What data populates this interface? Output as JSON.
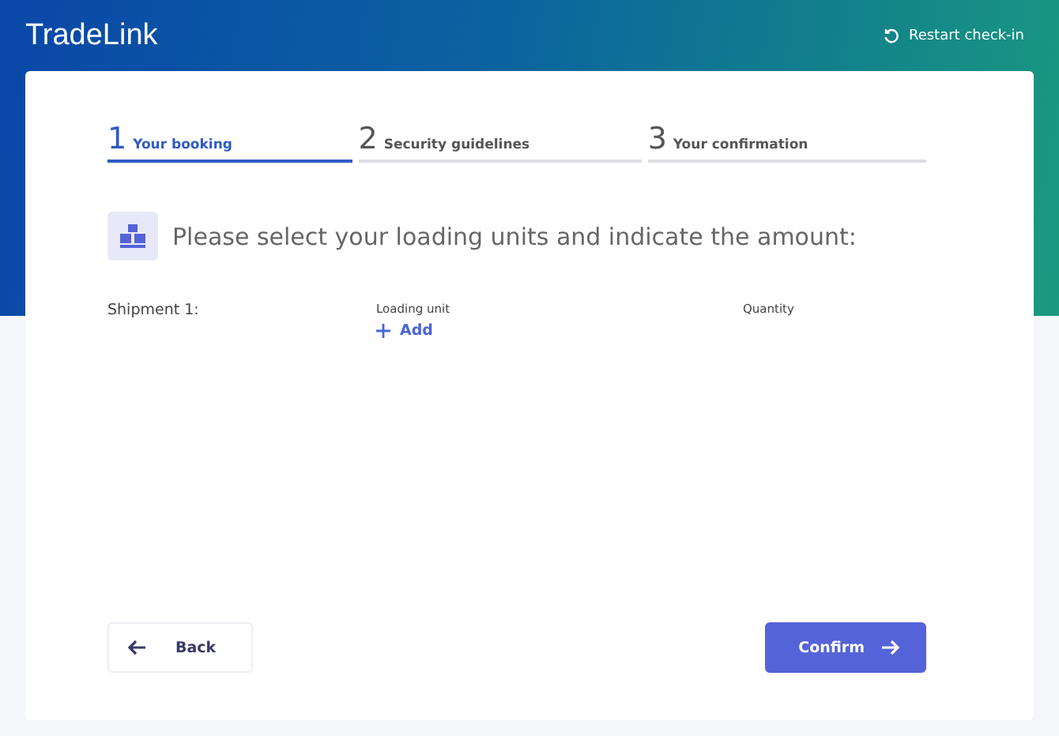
{
  "brand": "TradeLink",
  "restart": {
    "label": "Restart check-in"
  },
  "steps": [
    {
      "number": "1",
      "label": "Your booking",
      "selected": true
    },
    {
      "number": "2",
      "label": "Security guidelines",
      "selected": false
    },
    {
      "number": "3",
      "label": "Your confirmation",
      "selected": false
    }
  ],
  "heading": "Please select your loading units and indicate the amount:",
  "shipment": {
    "label": "Shipment 1:",
    "columns": [
      "Loading unit",
      "Quantity"
    ],
    "add_label": "Add"
  },
  "buttons": {
    "back": "Back",
    "confirm": "Confirm"
  }
}
